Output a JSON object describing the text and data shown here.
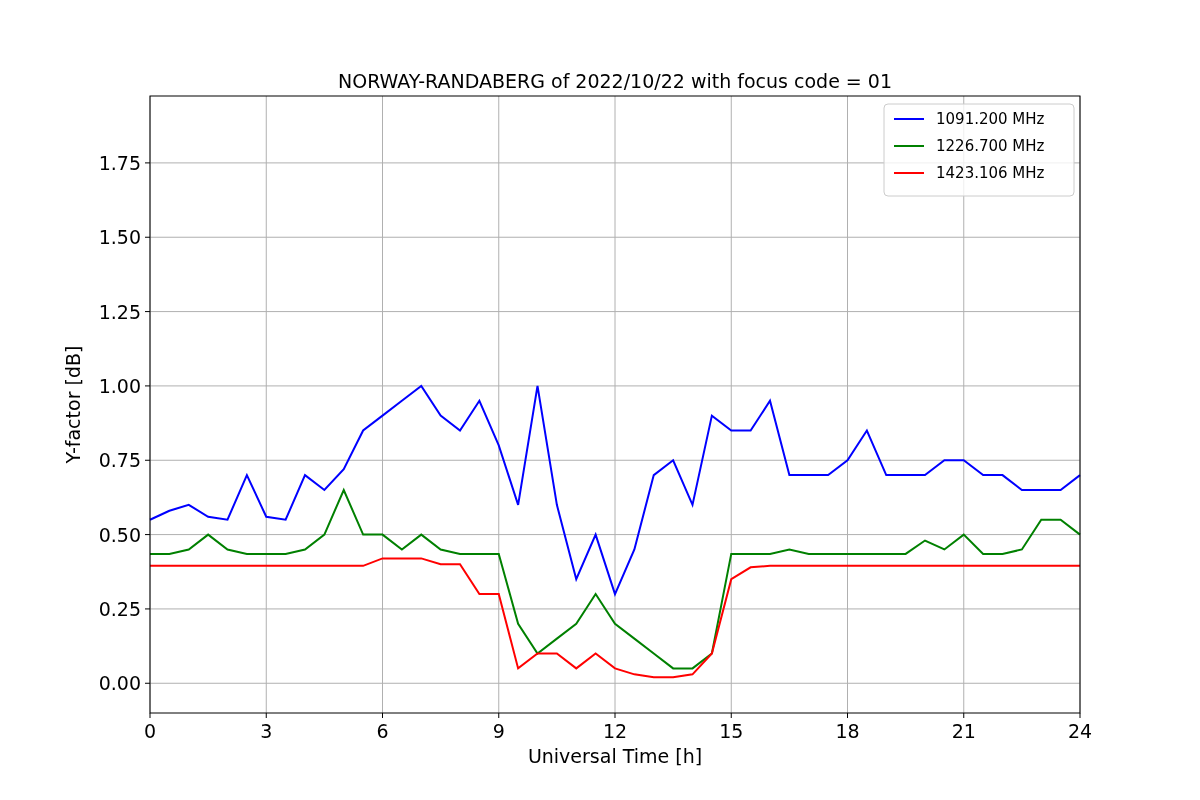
{
  "chart_data": {
    "type": "line",
    "title": "NORWAY-RANDABERG of 2022/10/22 with focus code = 01",
    "xlabel": "Universal Time [h]",
    "ylabel": "Y-factor [dB]",
    "x": [
      0,
      0.5,
      1,
      1.5,
      2,
      2.5,
      3,
      3.5,
      4,
      4.5,
      5,
      5.5,
      6,
      6.5,
      7,
      7.5,
      8,
      8.5,
      9,
      9.5,
      10,
      10.5,
      11,
      11.5,
      12,
      12.5,
      13,
      13.5,
      14,
      14.5,
      15,
      15.5,
      16,
      16.5,
      17,
      17.5,
      18,
      18.5,
      19,
      19.5,
      20,
      20.5,
      21,
      21.5,
      22,
      22.5,
      23,
      23.5,
      24
    ],
    "series": [
      {
        "name": "1091.200 MHz",
        "color": "#0000ff",
        "values": [
          0.55,
          0.58,
          0.6,
          0.56,
          0.55,
          0.7,
          0.56,
          0.55,
          0.7,
          0.65,
          0.72,
          0.85,
          0.9,
          0.95,
          1.0,
          0.9,
          0.85,
          0.95,
          0.8,
          0.6,
          1.0,
          0.6,
          0.35,
          0.5,
          0.3,
          0.45,
          0.7,
          0.75,
          0.6,
          0.9,
          0.85,
          0.85,
          0.95,
          0.7,
          0.7,
          0.7,
          0.75,
          0.85,
          0.7,
          0.7,
          0.7,
          0.75,
          0.75,
          0.7,
          0.7,
          0.65,
          0.65,
          0.65,
          0.7
        ]
      },
      {
        "name": "1226.700 MHz",
        "color": "#008000",
        "values": [
          0.435,
          0.435,
          0.45,
          0.5,
          0.45,
          0.435,
          0.435,
          0.435,
          0.45,
          0.5,
          0.65,
          0.5,
          0.5,
          0.45,
          0.5,
          0.45,
          0.435,
          0.435,
          0.435,
          0.2,
          0.1,
          0.15,
          0.2,
          0.3,
          0.2,
          0.15,
          0.1,
          0.05,
          0.05,
          0.1,
          0.435,
          0.435,
          0.435,
          0.45,
          0.435,
          0.435,
          0.435,
          0.435,
          0.435,
          0.435,
          0.48,
          0.45,
          0.5,
          0.435,
          0.435,
          0.45,
          0.55,
          0.55,
          0.5
        ]
      },
      {
        "name": "1423.106 MHz",
        "color": "#ff0000",
        "values": [
          0.395,
          0.395,
          0.395,
          0.395,
          0.395,
          0.395,
          0.395,
          0.395,
          0.395,
          0.395,
          0.395,
          0.395,
          0.42,
          0.42,
          0.42,
          0.4,
          0.4,
          0.3,
          0.3,
          0.05,
          0.1,
          0.1,
          0.05,
          0.1,
          0.05,
          0.03,
          0.02,
          0.02,
          0.03,
          0.1,
          0.35,
          0.39,
          0.395,
          0.395,
          0.395,
          0.395,
          0.395,
          0.395,
          0.395,
          0.395,
          0.395,
          0.395,
          0.395,
          0.395,
          0.395,
          0.395,
          0.395,
          0.395,
          0.395
        ]
      }
    ],
    "grid": true,
    "legend": true,
    "xlim": [
      0,
      24
    ],
    "ylim": [
      -0.1,
      1.975
    ],
    "xticks": [
      0,
      3,
      6,
      9,
      12,
      15,
      18,
      21,
      24
    ],
    "yticks": [
      {
        "value": 0,
        "label": "0.00"
      },
      {
        "value": 0.25,
        "label": "0.25"
      },
      {
        "value": 0.5,
        "label": "0.50"
      },
      {
        "value": 0.75,
        "label": "0.75"
      },
      {
        "value": 1,
        "label": "1.00"
      },
      {
        "value": 1.25,
        "label": "1.25"
      },
      {
        "value": 1.5,
        "label": "1.50"
      },
      {
        "value": 1.75,
        "label": "1.75"
      }
    ]
  }
}
